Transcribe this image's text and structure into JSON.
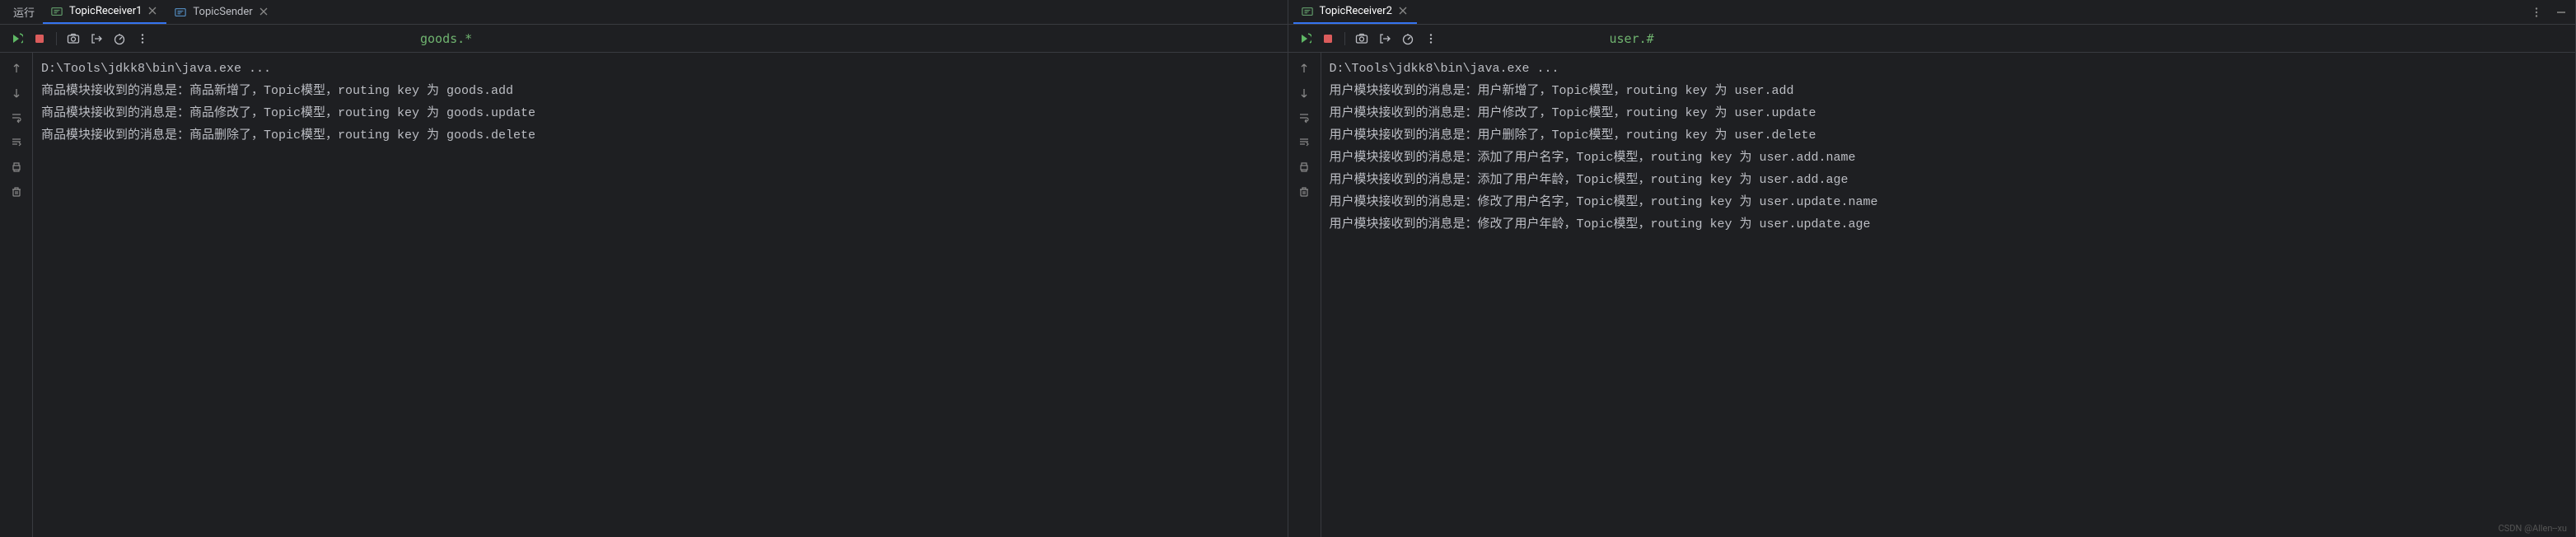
{
  "left": {
    "run_label": "运行",
    "tabs": [
      {
        "label": "TopicReceiver1",
        "active": true
      },
      {
        "label": "TopicSender",
        "active": false
      }
    ],
    "annotation": "goods.*",
    "console": {
      "command": "D:\\Tools\\jdkk8\\bin\\java.exe ...",
      "lines": [
        "商品模块接收到的消息是：商品新增了，Topic模型，routing key 为 goods.add",
        "商品模块接收到的消息是：商品修改了，Topic模型，routing key 为 goods.update",
        "商品模块接收到的消息是：商品删除了，Topic模型，routing key 为 goods.delete"
      ]
    }
  },
  "right": {
    "tabs": [
      {
        "label": "TopicReceiver2",
        "active": true
      }
    ],
    "annotation": "user.#",
    "console": {
      "command": "D:\\Tools\\jdkk8\\bin\\java.exe ...",
      "lines": [
        "用户模块接收到的消息是：用户新增了，Topic模型，routing key 为 user.add",
        "用户模块接收到的消息是：用户修改了，Topic模型，routing key 为 user.update",
        "用户模块接收到的消息是：用户删除了，Topic模型，routing key 为 user.delete",
        "用户模块接收到的消息是：添加了用户名字，Topic模型，routing key 为 user.add.name",
        "用户模块接收到的消息是：添加了用户年龄，Topic模型，routing key 为 user.add.age",
        "用户模块接收到的消息是：修改了用户名字，Topic模型，routing key 为 user.update.name",
        "用户模块接收到的消息是：修改了用户年龄，Topic模型，routing key 为 user.update.age"
      ]
    }
  },
  "watermark": "CSDN @Allen--xu"
}
